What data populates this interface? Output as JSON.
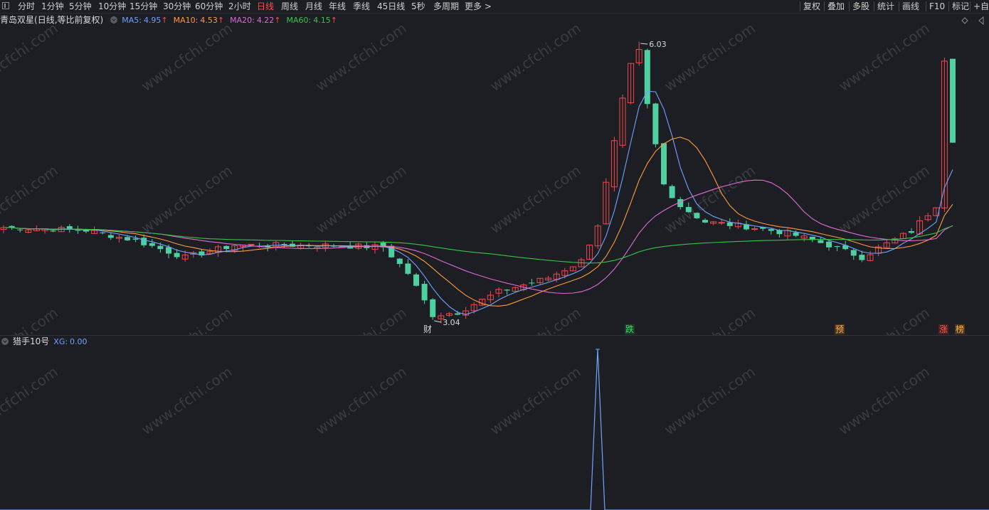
{
  "toolbar": {
    "timeframes": [
      {
        "label": "分时",
        "active": false
      },
      {
        "label": "1分钟",
        "active": false
      },
      {
        "label": "5分钟",
        "active": false
      },
      {
        "label": "10分钟",
        "active": false
      },
      {
        "label": "15分钟",
        "active": false
      },
      {
        "label": "30分钟",
        "active": false
      },
      {
        "label": "60分钟",
        "active": false
      },
      {
        "label": "2小时",
        "active": false
      },
      {
        "label": "日线",
        "active": true
      },
      {
        "label": "周线",
        "active": false
      },
      {
        "label": "月线",
        "active": false
      },
      {
        "label": "年线",
        "active": false
      },
      {
        "label": "季线",
        "active": false
      },
      {
        "label": "45日线",
        "active": false
      },
      {
        "label": "5秒",
        "active": false
      },
      {
        "label": "多周期",
        "active": false
      },
      {
        "label": "更多 >",
        "active": false
      }
    ],
    "right_tools": [
      "复权",
      "叠加",
      "多股",
      "统计",
      "画线",
      "F10",
      "标记",
      "+自"
    ]
  },
  "price_panel": {
    "stock_name": "青岛双星",
    "period_info": "(日线,等比前复权)",
    "ma": [
      {
        "label": "MA5:",
        "value": "4.95",
        "arrow": "↑",
        "color": "#6fa2ff"
      },
      {
        "label": "MA10:",
        "value": "4.53",
        "arrow": "↑",
        "color": "#ff9a3c"
      },
      {
        "label": "MA20:",
        "value": "4.22",
        "arrow": "↑",
        "color": "#e06ad6"
      },
      {
        "label": "MA60:",
        "value": "4.15",
        "arrow": "↑",
        "color": "#36c24a"
      }
    ],
    "high_label": "6.03",
    "low_label": "3.04",
    "markers": [
      {
        "text": "财",
        "color": "#d8d8d8",
        "bg": ""
      },
      {
        "text": "跌",
        "color": "#2ee06a",
        "bg": "#1f3a26"
      },
      {
        "text": "预",
        "color": "#ffb347",
        "bg": "#4a3520"
      },
      {
        "text": "涨",
        "color": "#ff5a5a",
        "bg": "#4a2020"
      },
      {
        "text": "榜",
        "color": "#ffb347",
        "bg": "#4a3520"
      }
    ]
  },
  "indicator_panel": {
    "name": "猎手10号",
    "xg_label": "XG:",
    "xg_value": "0.00"
  },
  "watermark": "www.cfchi.com",
  "colors": {
    "up": "#f0464d",
    "down": "#4ed0a0",
    "ma5": "#6fa2ff",
    "ma10": "#ff9a3c",
    "ma20": "#e06ad6",
    "ma60": "#36c24a",
    "xg": "#6fa2ff"
  }
}
